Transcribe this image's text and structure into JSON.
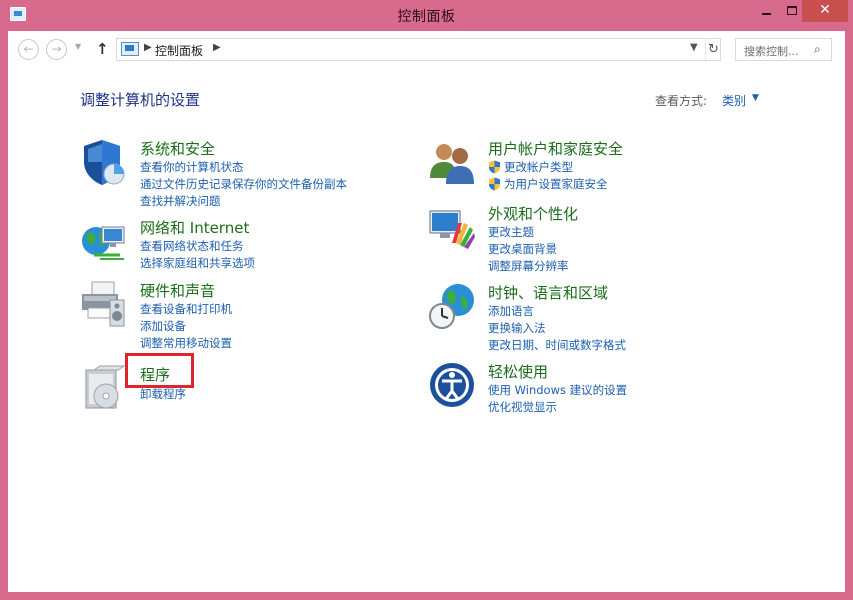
{
  "window": {
    "title": "控制面板",
    "controls": {
      "minimize": "—",
      "maximize": "□",
      "close": "✕"
    }
  },
  "navigation": {
    "back_icon": "back-arrow-icon",
    "forward_icon": "forward-arrow-icon",
    "up_icon": "up-arrow-icon",
    "breadcrumb": "控制面板",
    "search_placeholder": "搜索控制...",
    "refresh_icon": "refresh-icon"
  },
  "header": {
    "title": "调整计算机的设置",
    "view_by_label": "查看方式:",
    "view_by_value": "类别"
  },
  "categories": [
    {
      "title": "系统和安全",
      "icon": "shield-icon",
      "links": [
        "查看你的计算机状态",
        "通过文件历史记录保存你的文件备份副本",
        "查找并解决问题"
      ]
    },
    {
      "title": "网络和 Internet",
      "icon": "network-globe-icon",
      "links": [
        "查看网络状态和任务",
        "选择家庭组和共享选项"
      ]
    },
    {
      "title": "硬件和声音",
      "icon": "printer-icon",
      "links": [
        "查看设备和打印机",
        "添加设备",
        "调整常用移动设置"
      ]
    },
    {
      "title": "程序",
      "icon": "programs-icon",
      "links": [
        "卸载程序"
      ]
    },
    {
      "title": "用户帐户和家庭安全",
      "icon": "users-icon",
      "links": [
        "更改帐户类型",
        "为用户设置家庭安全"
      ]
    },
    {
      "title": "外观和个性化",
      "icon": "monitor-palette-icon",
      "links": [
        "更改主题",
        "更改桌面背景",
        "调整屏幕分辨率"
      ]
    },
    {
      "title": "时钟、语言和区域",
      "icon": "clock-globe-icon",
      "links": [
        "添加语言",
        "更换输入法",
        "更改日期、时间或数字格式"
      ]
    },
    {
      "title": "轻松使用",
      "icon": "ease-of-access-icon",
      "links": [
        "使用 Windows 建议的设置",
        "优化视觉显示"
      ]
    }
  ],
  "colors": {
    "window_frame": "#d86a8e",
    "category_title": "#1a6e1a",
    "link": "#1d5fb0",
    "highlight": "#e0242c"
  }
}
